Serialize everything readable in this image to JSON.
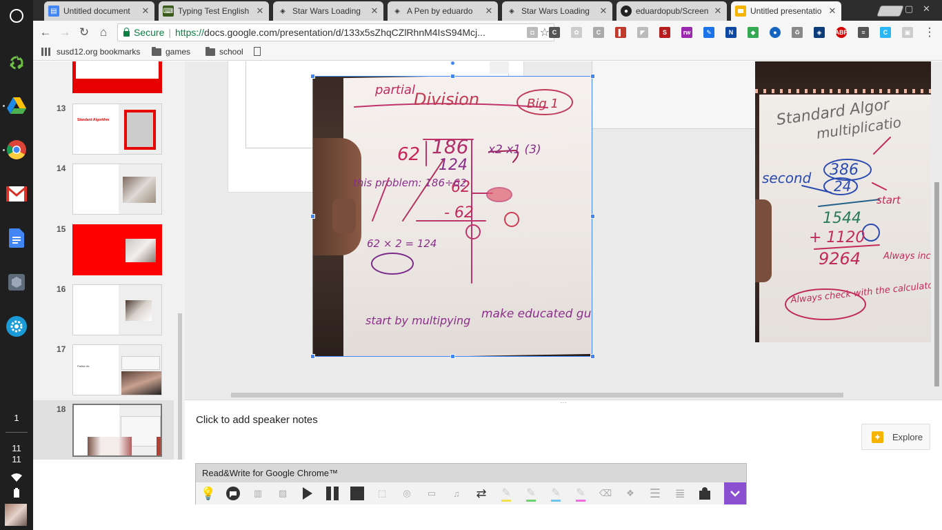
{
  "shelf": {
    "apps": [
      "recycle-app-icon",
      "google-drive-icon",
      "chrome-icon",
      "gmail-icon",
      "google-docs-icon",
      "app-box-icon",
      "settings-icon"
    ],
    "workspace": "1",
    "time_hour": "11",
    "time_minute": "11"
  },
  "tabs": [
    {
      "title": "Untitled document",
      "icon": "docs-tab-icon",
      "color": "#4285f4",
      "active": false
    },
    {
      "title": "Typing Test English",
      "icon": "typing-test-tab-icon",
      "color": "#3a5a1c",
      "active": false
    },
    {
      "title": "Star Wars Loading",
      "icon": "codepen-tab-icon",
      "color": "#333333",
      "active": false
    },
    {
      "title": "A Pen by eduardo",
      "icon": "codepen-tab-icon",
      "color": "#333333",
      "active": false
    },
    {
      "title": "Star Wars Loading",
      "icon": "codepen-tab-icon",
      "color": "#333333",
      "active": false
    },
    {
      "title": "eduardopub/Screen",
      "icon": "github-tab-icon",
      "color": "#222222",
      "active": false
    },
    {
      "title": "Untitled presentatio",
      "icon": "slides-tab-icon",
      "color": "#f4b400",
      "active": true
    }
  ],
  "omnibox": {
    "secure_label": "Secure",
    "url_scheme": "https://",
    "url_rest": "docs.google.com/presentation/d/133x5sZhqCZlRhnM4IsS94Mcj..."
  },
  "bookmarks": [
    {
      "label": "susd12.org bookmarks",
      "type": "apps"
    },
    {
      "label": "games",
      "type": "folder"
    },
    {
      "label": "school",
      "type": "folder"
    }
  ],
  "filmstrip": {
    "slides": [
      {
        "number": "13",
        "thumb_text": "Standard Algorithm"
      },
      {
        "number": "14",
        "thumb_text": ""
      },
      {
        "number": "15",
        "thumb_text": ""
      },
      {
        "number": "16",
        "thumb_text": ""
      },
      {
        "number": "17",
        "thumb_text": "Partial div"
      },
      {
        "number": "18",
        "thumb_text": ""
      }
    ],
    "selected": "18"
  },
  "canvas": {
    "photo_left_text": {
      "title": "Division",
      "top": "partial",
      "badge": "Big 1",
      "divisor": "62",
      "dividend": "186",
      "step1": "124",
      "step2": "62",
      "step3": "- 62",
      "remainder": "0",
      "note1": "this problem: 186÷62",
      "note2": "62 × 2 = 124",
      "note3": "start by multipying",
      "note4": "make educated guess!",
      "right_col": "x2  x1  (3)"
    },
    "photo_right_text": {
      "title": "Standard Algor",
      "subtitle": "multiplicatio",
      "top": "386",
      "mult": "24",
      "label_second": "second",
      "label_start": "start",
      "partial1": "1544",
      "partial2": "+ 1120",
      "result": "9264",
      "note": "Always check with the calculator",
      "side": "Always include zero"
    }
  },
  "notes": {
    "placeholder": "Click to add speaker notes",
    "explore_label": "Explore"
  },
  "readwrite": {
    "title": "Read&Write for Google Chrome™",
    "accent": "#8a4fd1"
  }
}
